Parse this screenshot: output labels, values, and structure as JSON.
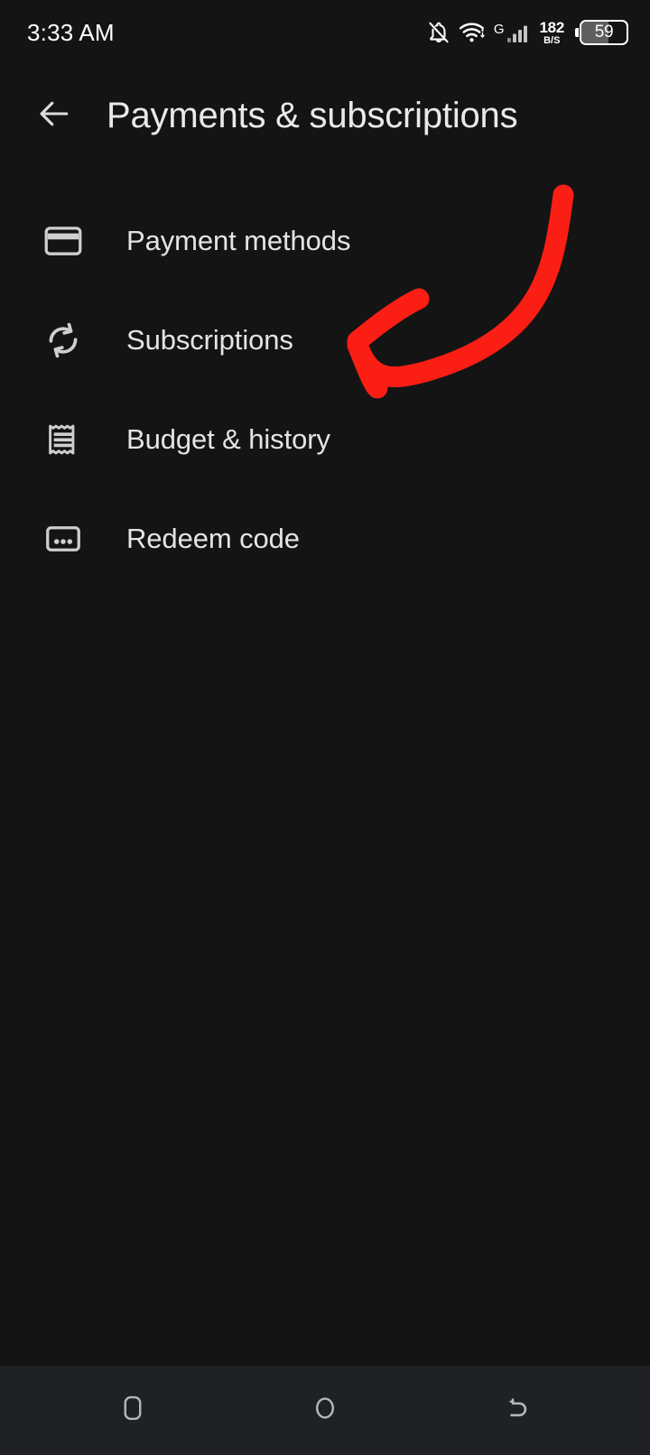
{
  "status_bar": {
    "time": "3:33 AM",
    "icons": {
      "notifications": "bell-off-icon",
      "wifi": "wifi-icon",
      "network_type": "G",
      "signal": "signal-bars-icon"
    },
    "data_speed": {
      "value": "182",
      "unit": "B/S"
    },
    "battery": {
      "level": "59",
      "percent": 59
    }
  },
  "app_bar": {
    "back_icon": "arrow-left-icon",
    "title": "Payments & subscriptions"
  },
  "menu": {
    "items": [
      {
        "label": "Payment methods",
        "icon": "credit-card-icon"
      },
      {
        "label": "Subscriptions",
        "icon": "sync-refresh-icon"
      },
      {
        "label": "Budget & history",
        "icon": "receipt-icon"
      },
      {
        "label": "Redeem code",
        "icon": "redeem-dots-icon"
      }
    ]
  },
  "annotation": {
    "type": "hand-drawn-arrow",
    "color": "#fa1e14",
    "points_to": "Subscriptions"
  },
  "nav_bar": {
    "buttons": [
      {
        "name": "recents-button",
        "icon": "rounded-square-icon"
      },
      {
        "name": "home-button",
        "icon": "circle-icon"
      },
      {
        "name": "back-button",
        "icon": "back-hook-icon"
      }
    ]
  },
  "colors": {
    "background": "#141414",
    "nav_background": "#1f2124",
    "text": "#e8e8e8",
    "annotation": "#fa1e14"
  }
}
